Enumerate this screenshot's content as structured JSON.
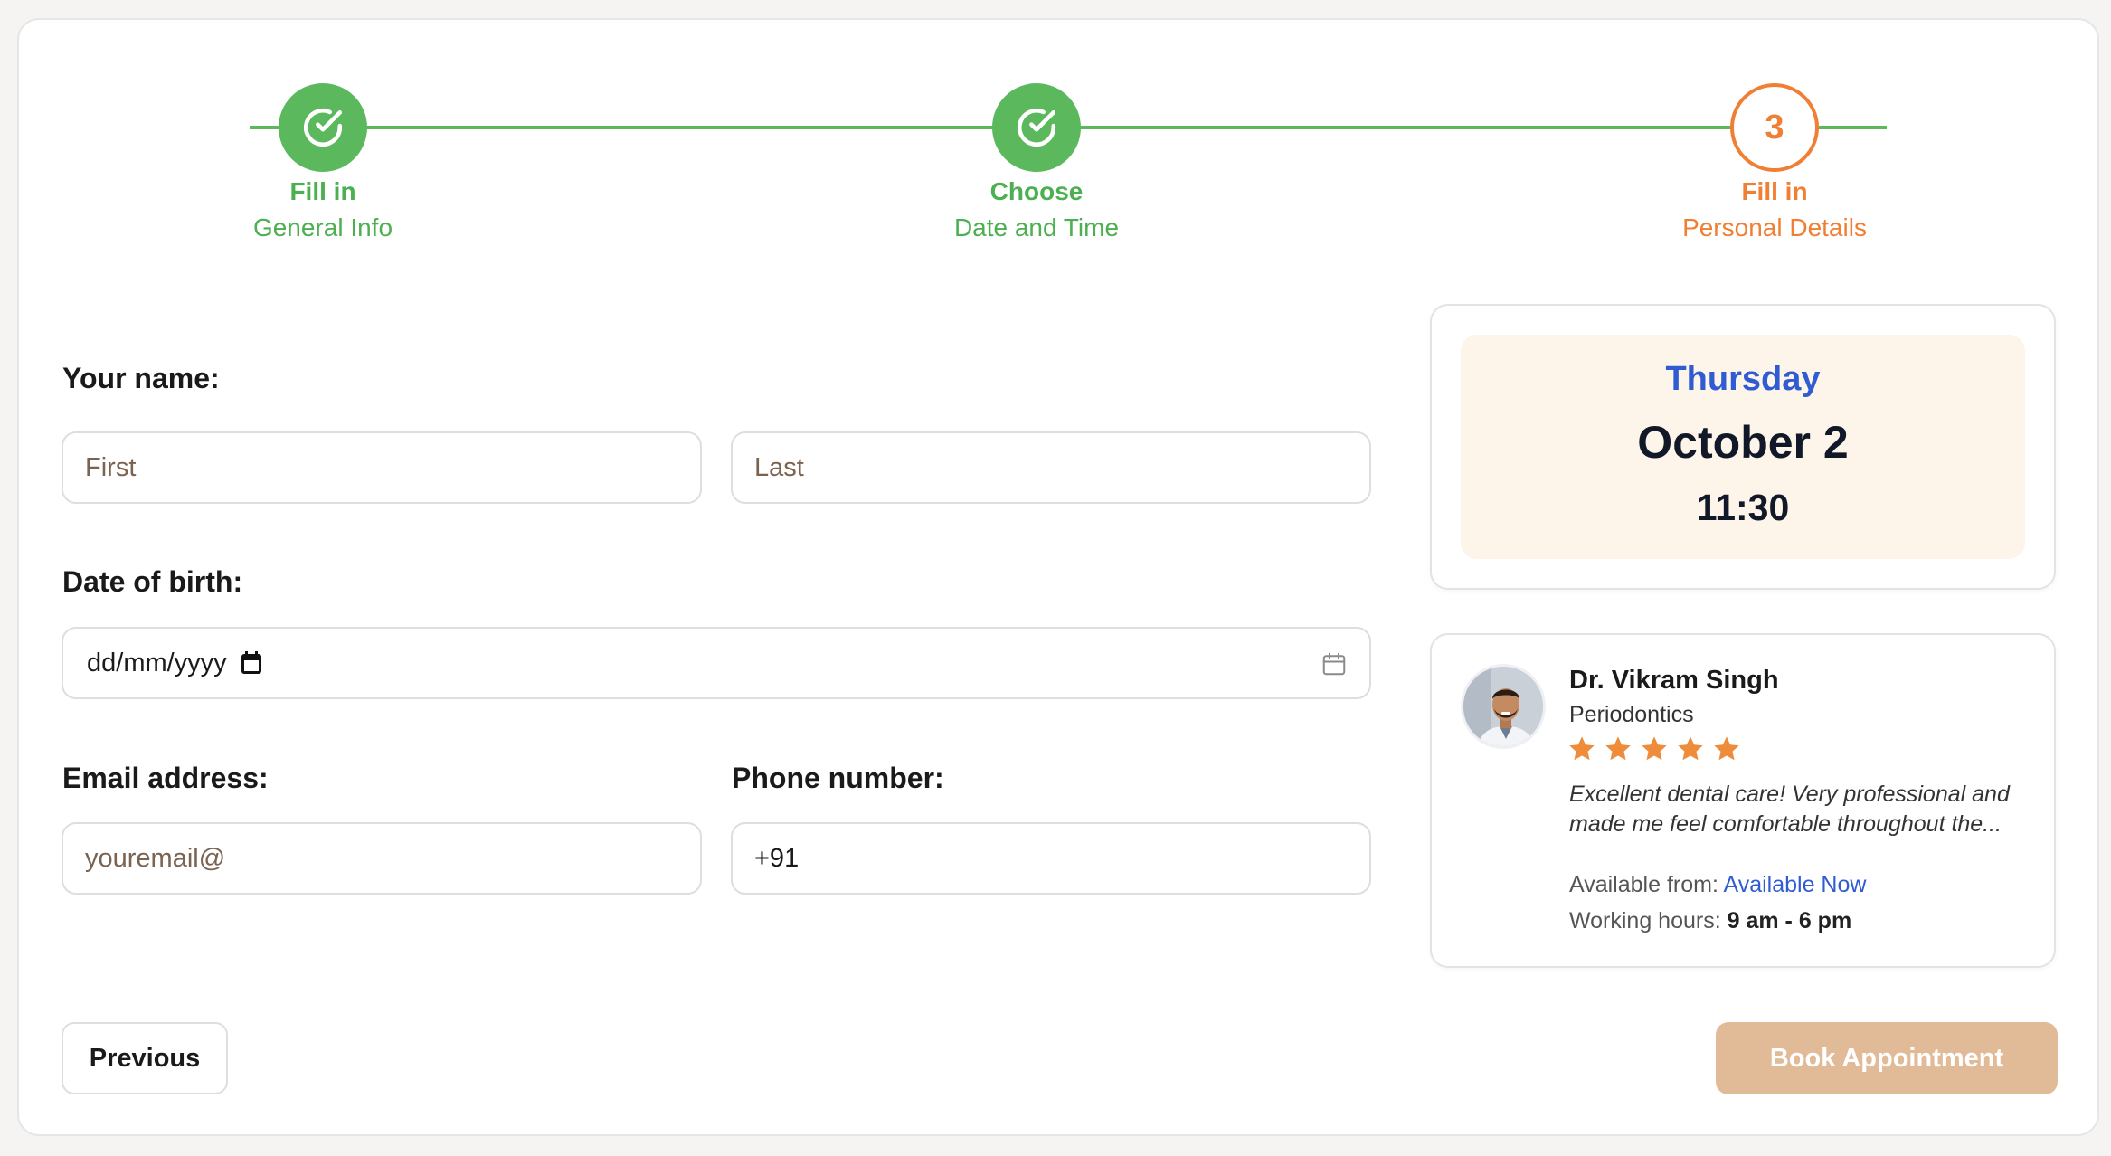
{
  "stepper": {
    "steps": [
      {
        "line1": "Fill in",
        "line2": "General Info",
        "status": "done"
      },
      {
        "line1": "Choose",
        "line2": "Date and Time",
        "status": "done"
      },
      {
        "line1": "Fill in",
        "line2": "Personal Details",
        "status": "current",
        "number": "3"
      }
    ]
  },
  "form": {
    "name_label": "Your name:",
    "first_placeholder": "First",
    "last_placeholder": "Last",
    "dob_label": "Date of birth:",
    "dob_value": "dd/mm/yyyy",
    "email_label": "Email address:",
    "email_placeholder": "youremail@",
    "phone_label": "Phone number:",
    "phone_value": "+91"
  },
  "appointment": {
    "day": "Thursday",
    "date": "October 2",
    "time": "11:30"
  },
  "doctor": {
    "name": "Dr. Vikram Singh",
    "specialty": "Periodontics",
    "rating": 5,
    "review": "Excellent dental care! Very professional and made me feel comfortable throughout the...",
    "available_label": "Available from:",
    "available_value": "Available Now",
    "hours_label": "Working hours:",
    "hours_value": "9 am - 6 pm"
  },
  "buttons": {
    "previous": "Previous",
    "book": "Book Appointment"
  },
  "colors": {
    "done": "#5cb85c",
    "current": "#f07f33",
    "accent_blue": "#2f5bd3",
    "book_button": "#e1bb98"
  }
}
